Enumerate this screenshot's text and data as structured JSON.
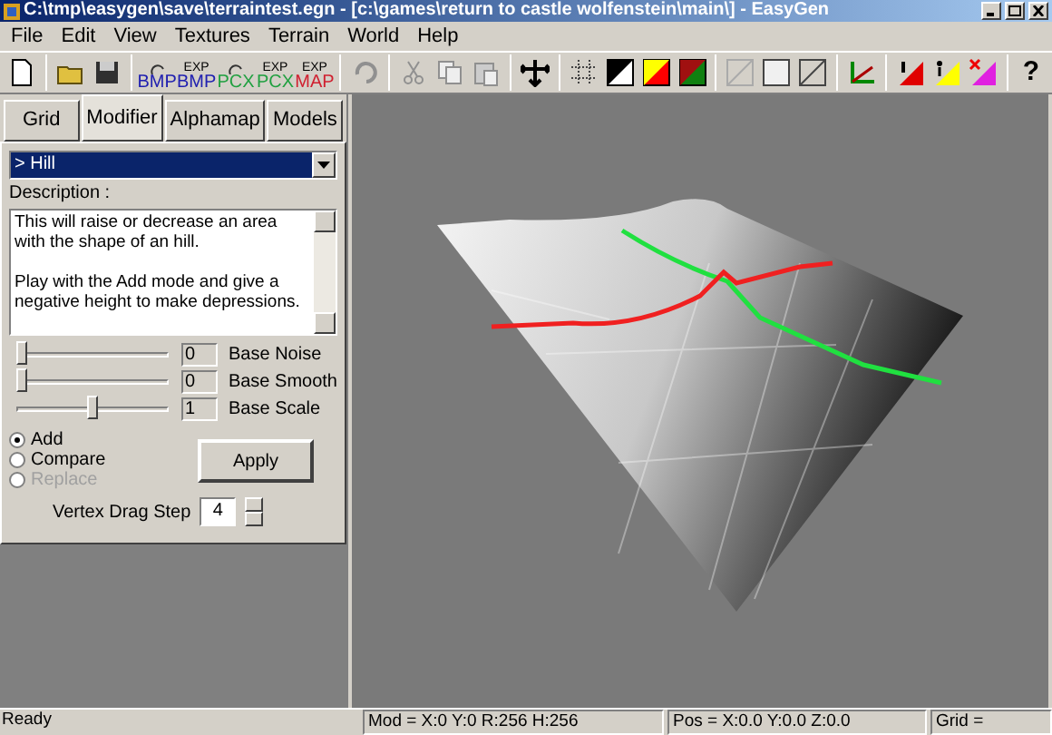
{
  "window": {
    "title": "C:\\tmp\\easygen\\save\\terraintest.egn - [c:\\games\\return to castle wolfenstein\\main\\] - EasyGen"
  },
  "menu": [
    "File",
    "Edit",
    "View",
    "Textures",
    "Terrain",
    "World",
    "Help"
  ],
  "toolbar": {
    "file_buttons": [
      {
        "kind": "import",
        "label": "BMP",
        "color": "#2020b0"
      },
      {
        "kind": "export",
        "top": "EXP",
        "label": "BMP",
        "color": "#2020b0"
      },
      {
        "kind": "import",
        "label": "PCX",
        "color": "#20a040"
      },
      {
        "kind": "export",
        "top": "EXP",
        "label": "PCX",
        "color": "#20a040"
      },
      {
        "kind": "export",
        "top": "EXP",
        "label": "MAP",
        "color": "#d02030"
      }
    ],
    "edit_buttons": [
      {
        "kind": "undo",
        "disabled": true
      },
      {
        "kind": "cut",
        "disabled": true
      },
      {
        "kind": "copy",
        "disabled": true
      },
      {
        "kind": "paste",
        "disabled": true
      }
    ],
    "help": "?"
  },
  "tabs": [
    {
      "label": "Grid",
      "selected": false
    },
    {
      "label": "Modifier",
      "selected": true
    },
    {
      "label": "Alphamap",
      "selected": false
    },
    {
      "label": "Models",
      "selected": false
    }
  ],
  "modifier": {
    "dropdown": "> Hill",
    "description_label": "Description :",
    "description": [
      "This will raise or decrease an area with the shape of an hill.",
      "Play with the Add mode and give a negative height to make depressions."
    ],
    "sliders": [
      {
        "name": "Base Noise",
        "value": "0",
        "level": 0
      },
      {
        "name": "Base Smooth",
        "value": "0",
        "level": 0
      },
      {
        "name": "Base Scale",
        "value": "1",
        "level": 0.5
      }
    ],
    "radios": [
      {
        "label": "Add",
        "selected": true,
        "disabled": false
      },
      {
        "label": "Compare",
        "selected": false,
        "disabled": false
      },
      {
        "label": "Replace",
        "selected": false,
        "disabled": true
      }
    ],
    "apply": "Apply",
    "vertex_step": {
      "label": "Vertex Drag Step",
      "value": "4"
    }
  },
  "status_bar": [
    "Ready",
    "Mod = X:0 Y:0 R:256 H:256",
    "Pos = X:0.0 Y:0.0 Z:0.0",
    "Grid ="
  ]
}
